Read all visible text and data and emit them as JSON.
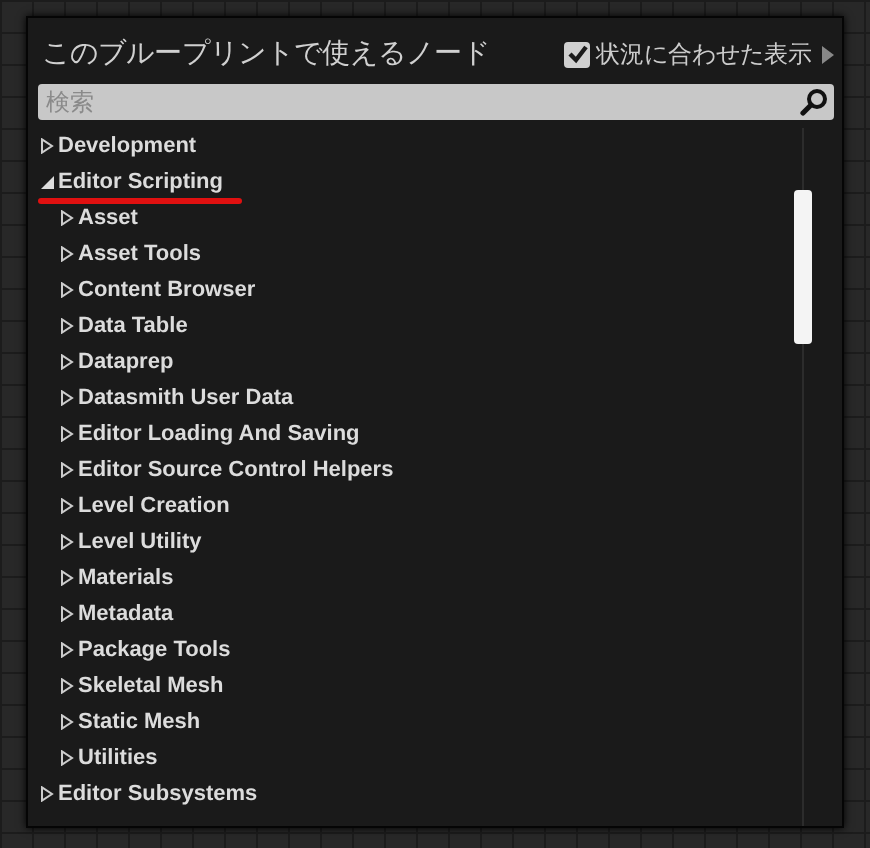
{
  "panel": {
    "title": "このブループリントで使えるノード",
    "context_toggle": {
      "label": "状況に合わせた表示",
      "checked": true
    }
  },
  "search": {
    "placeholder": "検索"
  },
  "tree": [
    {
      "label": "Development",
      "expanded": false,
      "underlined": false
    },
    {
      "label": "Editor Scripting",
      "expanded": true,
      "underlined": true,
      "children": [
        {
          "label": "Asset",
          "expanded": false
        },
        {
          "label": "Asset Tools",
          "expanded": false
        },
        {
          "label": "Content Browser",
          "expanded": false
        },
        {
          "label": "Data Table",
          "expanded": false
        },
        {
          "label": "Dataprep",
          "expanded": false
        },
        {
          "label": "Datasmith User Data",
          "expanded": false
        },
        {
          "label": "Editor Loading And Saving",
          "expanded": false
        },
        {
          "label": "Editor Source Control Helpers",
          "expanded": false
        },
        {
          "label": "Level Creation",
          "expanded": false
        },
        {
          "label": "Level Utility",
          "expanded": false
        },
        {
          "label": "Materials",
          "expanded": false
        },
        {
          "label": "Metadata",
          "expanded": false
        },
        {
          "label": "Package Tools",
          "expanded": false
        },
        {
          "label": "Skeletal Mesh",
          "expanded": false
        },
        {
          "label": "Static Mesh",
          "expanded": false
        },
        {
          "label": "Utilities",
          "expanded": false
        }
      ]
    },
    {
      "label": "Editor Subsystems",
      "expanded": false,
      "underlined": false
    }
  ]
}
